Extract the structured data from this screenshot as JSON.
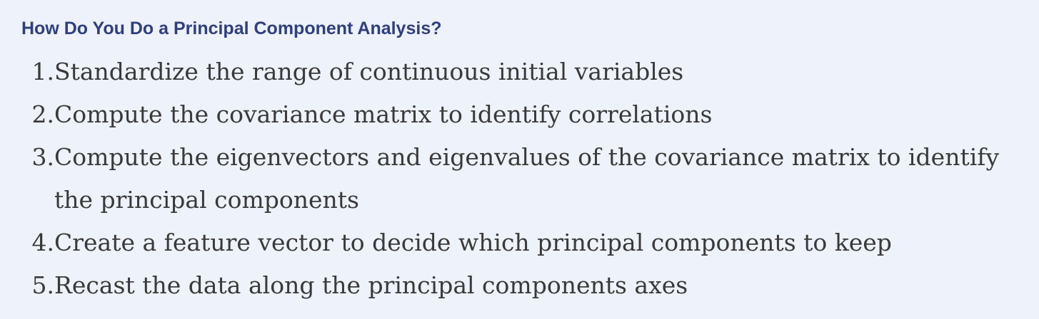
{
  "heading": "How Do You Do a Principal Component Analysis?",
  "steps": [
    {
      "number": "1.",
      "text": "Standardize the range of continuous initial variables"
    },
    {
      "number": "2.",
      "text": "Compute the covariance matrix to identify correlations"
    },
    {
      "number": "3.",
      "text": "Compute the eigenvectors and eigenvalues of the covariance matrix to identify the principal components"
    },
    {
      "number": "4.",
      "text": "Create a feature vector to decide which principal components to keep"
    },
    {
      "number": "5.",
      "text": "Recast the data along the principal components axes"
    }
  ]
}
